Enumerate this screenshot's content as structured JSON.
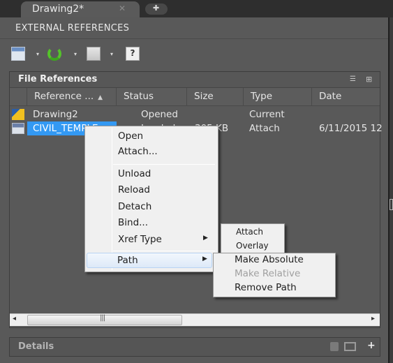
{
  "tabs": {
    "active": {
      "label": "Drawing2*",
      "close_icon": "close-icon"
    },
    "new_tab_icon": "plus-icon"
  },
  "panel": {
    "title": "EXTERNAL REFERENCES"
  },
  "toolbar": {
    "items": [
      {
        "name": "attach-dwg",
        "icon": "attach-dwg-icon",
        "has_dropdown": true
      },
      {
        "name": "refresh",
        "icon": "refresh-icon",
        "has_dropdown": true
      },
      {
        "name": "change-path",
        "icon": "change-path-icon",
        "has_dropdown": true
      },
      {
        "name": "help",
        "icon": "help-icon",
        "glyph": "?"
      }
    ],
    "dropdown_glyph": "▾"
  },
  "file_references": {
    "title": "File References",
    "view_icons": [
      "list-view-icon",
      "tree-view-icon"
    ],
    "columns": [
      "Reference ...",
      "Status",
      "Size",
      "Type",
      "Date"
    ],
    "sort_indicator": "▲",
    "rows": [
      {
        "icon": "drawing-icon",
        "name": "Drawing2",
        "status": "Opened",
        "size": "",
        "type": "Current",
        "date": ""
      },
      {
        "icon": "xref-dwg-icon",
        "name": "CIVIL_TEMPLE",
        "status": "Loaded",
        "size": "305 KB",
        "type": "Attach",
        "date": "6/11/2015 12",
        "selected": true
      }
    ]
  },
  "scrollbar": {
    "left_arrow": "◂",
    "right_arrow": "▸",
    "grip": "|||",
    "position_fraction": 0.0,
    "visible_fraction": 0.42
  },
  "details": {
    "title": "Details",
    "icons": [
      "preview-icon",
      "thumbnail-icon",
      "expand-icon"
    ],
    "expand_glyph": "+"
  },
  "context_menu": {
    "items": [
      {
        "label": "Open"
      },
      {
        "label": "Attach..."
      },
      {
        "separator": true
      },
      {
        "label": "Unload"
      },
      {
        "label": "Reload"
      },
      {
        "label": "Detach"
      },
      {
        "label": "Bind..."
      },
      {
        "label": "Xref Type",
        "submenu": true
      },
      {
        "separator": true
      },
      {
        "label": "Path",
        "submenu": true,
        "highlighted": true
      }
    ],
    "submenu_arrow": "▶"
  },
  "xref_type_submenu": {
    "items": [
      {
        "label": "Attach"
      },
      {
        "label": "Overlay"
      }
    ]
  },
  "path_submenu": {
    "items": [
      {
        "label": "Make Absolute",
        "enabled": true
      },
      {
        "label": "Make Relative",
        "enabled": false
      },
      {
        "label": "Remove Path",
        "enabled": true
      }
    ]
  },
  "colors": {
    "selection": "#3399f3",
    "panel_bg": "#595959",
    "menu_bg": "#f0f0f0",
    "refresh_green": "#54c32a"
  }
}
